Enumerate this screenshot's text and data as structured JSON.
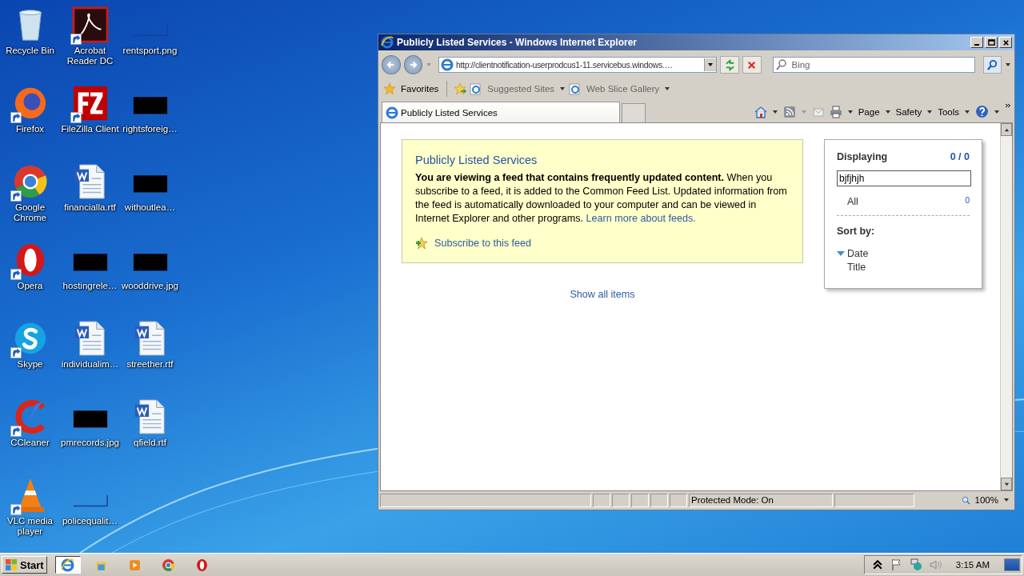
{
  "desktop_icons": [
    {
      "label": "Recycle Bin",
      "kind": "recycle",
      "shortcut": false
    },
    {
      "label": "Firefox",
      "kind": "firefox",
      "shortcut": true
    },
    {
      "label": "Google Chrome",
      "kind": "chrome",
      "shortcut": true
    },
    {
      "label": "Opera",
      "kind": "opera",
      "shortcut": true
    },
    {
      "label": "Skype",
      "kind": "skype",
      "shortcut": true
    },
    {
      "label": "CCleaner",
      "kind": "ccleaner",
      "shortcut": true
    },
    {
      "label": "VLC media player",
      "kind": "vlc",
      "shortcut": true
    },
    {
      "label": "Acrobat Reader DC",
      "kind": "acrobat",
      "shortcut": true
    },
    {
      "label": "FileZilla Client",
      "kind": "filezilla",
      "shortcut": true
    },
    {
      "label": "financialla.rtf",
      "kind": "word",
      "shortcut": false
    },
    {
      "label": "hostingrele…",
      "kind": "image-black",
      "shortcut": false
    },
    {
      "label": "individualim…",
      "kind": "word",
      "shortcut": false
    },
    {
      "label": "pmrecords.jpg",
      "kind": "image-black",
      "shortcut": false
    },
    {
      "label": "policequalit…",
      "kind": "image-blank",
      "shortcut": false
    },
    {
      "label": "rentsport.png",
      "kind": "image-blank",
      "shortcut": false
    },
    {
      "label": "rightsforeig…",
      "kind": "image-black",
      "shortcut": false
    },
    {
      "label": "withoutlea…",
      "kind": "image-black",
      "shortcut": false
    },
    {
      "label": "wooddrive.jpg",
      "kind": "image-black",
      "shortcut": false
    },
    {
      "label": "streether.rtf",
      "kind": "word",
      "shortcut": false
    },
    {
      "label": "qfield.rtf",
      "kind": "word",
      "shortcut": false
    }
  ],
  "window": {
    "title": "Publicly Listed Services - Windows Internet Explorer",
    "address": "http://clientnotification-userprodcus1-11.servicebus.windows.…",
    "search_placeholder": "Bing",
    "favorites_label": "Favorites",
    "favorites_links": [
      "Suggested Sites",
      "Web Slice Gallery"
    ],
    "tabs": [
      {
        "label": "Publicly Listed Services",
        "selected": true
      }
    ],
    "commands": [
      "Page",
      "Safety",
      "Tools"
    ]
  },
  "feed": {
    "title": "Publicly Listed Services",
    "message": "**You are viewing a feed that contains frequently updated content.** When you subscribe to a feed, it is added to the Common Feed List. Updated information from the feed is automatically downloaded to your computer and can be viewed in Internet Explorer and other programs.",
    "learn_more": "Learn more about feeds.",
    "subscribe": "Subscribe to this feed",
    "show_all": "Show all items"
  },
  "sidebar": {
    "heading": "Displaying",
    "count": "0 / 0",
    "filter_value": "bjfjhjh",
    "filters": [
      {
        "label": "All",
        "count": "0"
      }
    ],
    "sort_heading": "Sort by:",
    "sort_options": [
      {
        "label": "Date",
        "selected": true
      },
      {
        "label": "Title",
        "selected": false
      }
    ]
  },
  "status_bar": {
    "protected_mode": "Protected Mode: On",
    "zoom": "100%"
  },
  "taskbar": {
    "start_label": "Start",
    "apps": [
      {
        "kind": "ie",
        "selected": true
      },
      {
        "kind": "explorer",
        "selected": false
      },
      {
        "kind": "media",
        "selected": false
      },
      {
        "kind": "chrome",
        "selected": false
      },
      {
        "kind": "opera",
        "selected": false
      }
    ],
    "clock": "3:15 AM"
  }
}
